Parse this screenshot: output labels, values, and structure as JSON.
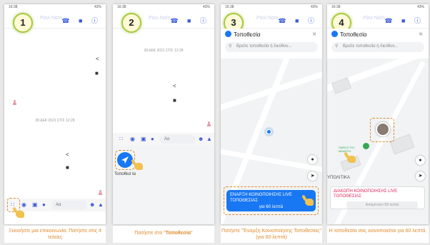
{
  "status": {
    "time": "16:38",
    "right": "43%"
  },
  "header": {
    "name": "Ράνι Ναίτι",
    "icons": "☎ ■ ⓘ"
  },
  "steps": [
    {
      "number": "1",
      "caption": "Ξεκινήστε μια επικοινωνία. Πατήστε στις 4 τελείες"
    },
    {
      "number": "2",
      "caption_prefix": "Πατήστε στο \"",
      "caption_bold": "Τοποθεσία",
      "caption_suffix": "\""
    },
    {
      "number": "3",
      "caption": "Πατήστε \"Έναρξη Κοινοποίησης Τοποθεσίας\" (για 60 λεπτά)"
    },
    {
      "number": "4",
      "caption": "Η τοποθεσία σας κοινοποιείται για 60 λεπτά."
    }
  ],
  "chat": {
    "date1": "28 ΔΕΚ 2021 ΣΤΙΣ 12:28",
    "date2": "28 ΔΕΚ 2021 ΣΤΙΣ 12:28",
    "composer_placeholder": "Αα"
  },
  "location_button_label": "Τοποθεσ ία",
  "map": {
    "title": "Τοποθεσία",
    "search_placeholder": "Βρείτε τοποθεσία ή διεύθυν...",
    "live_line1": "ΕΝΑΡΞΗ ΚΟΙΝΟΠΟΙΗΣΗΣ LIVE",
    "live_line2": "ΤΟΠΟΘΕΣΙΑΣ",
    "live_line3": "για 60 λεπτά",
    "stop_line1": "ΔΙΑΚΟΠΗ ΚΟΙΝΟΠΟΙΗΣΗΣ LIVE",
    "stop_line2": "ΤΟΠΟΘΕΣΙΑΣ",
    "stop_remaining": "Απομένουν 59 λεπτά",
    "park_label": "ΠΑΡΚΟ ΤΟΥ ΜΑΘΗΤΗ",
    "area_label": "ΥΠΟΛΙΤΙΚΑ"
  },
  "colors": {
    "accent": "#1877f2",
    "step_border": "#a7cb3f",
    "caption_text": "#e08a2c",
    "stop_red": "#e0245e"
  }
}
